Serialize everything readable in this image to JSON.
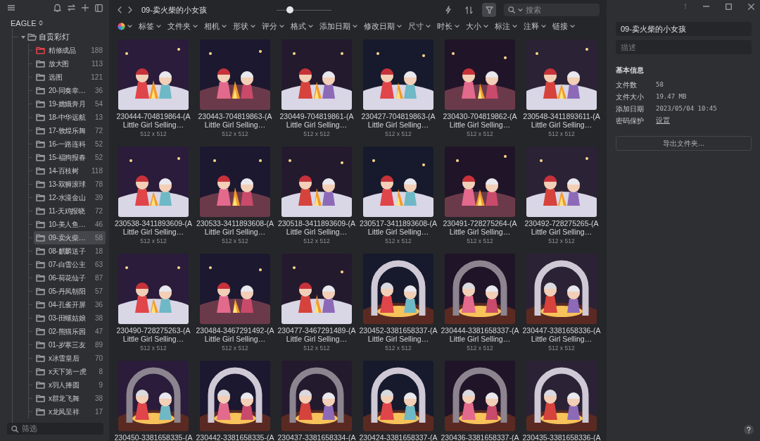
{
  "sidebar": {
    "library": "EAGLE",
    "root": {
      "name": "自贡彩灯",
      "expanded": true,
      "children": [
        {
          "name": "精修成品",
          "count": "188",
          "color": "#d9434b",
          "selected": false
        },
        {
          "name": "放大图",
          "count": "113",
          "color": "#9a9ba0",
          "selected": false
        },
        {
          "name": "选图",
          "count": "121",
          "color": "#9a9ba0",
          "selected": false
        },
        {
          "name": "20-同奏幸…",
          "count": "36",
          "color": "#9a9ba0",
          "selected": false
        },
        {
          "name": "19-嫦娥奔月",
          "count": "54",
          "color": "#9a9ba0",
          "selected": false
        },
        {
          "name": "18-中华远航",
          "count": "13",
          "color": "#9a9ba0",
          "selected": false
        },
        {
          "name": "17-敦煌乐舞",
          "count": "72",
          "color": "#9a9ba0",
          "selected": false
        },
        {
          "name": "16-一路连科",
          "count": "52",
          "color": "#9a9ba0",
          "selected": false
        },
        {
          "name": "15-福狗报春",
          "count": "52",
          "color": "#9a9ba0",
          "selected": false
        },
        {
          "name": "14-百枝树",
          "count": "118",
          "color": "#9a9ba0",
          "selected": false
        },
        {
          "name": "13-双狮滚球",
          "count": "78",
          "color": "#9a9ba0",
          "selected": false
        },
        {
          "name": "12-水漫金山",
          "count": "39",
          "color": "#9a9ba0",
          "selected": false
        },
        {
          "name": "11-天鸡报晓",
          "count": "72",
          "color": "#9a9ba0",
          "selected": false
        },
        {
          "name": "10-美人鱼…",
          "count": "46",
          "color": "#9a9ba0",
          "selected": false
        },
        {
          "name": "09-卖火柴…",
          "count": "58",
          "color": "#9a9ba0",
          "selected": true
        },
        {
          "name": "08-麒麟送子",
          "count": "18",
          "color": "#9a9ba0",
          "selected": false
        },
        {
          "name": "07-白雪公主",
          "count": "63",
          "color": "#9a9ba0",
          "selected": false
        },
        {
          "name": "06-荷花仙子",
          "count": "87",
          "color": "#9a9ba0",
          "selected": false
        },
        {
          "name": "05-丹凤朝阳",
          "count": "57",
          "color": "#9a9ba0",
          "selected": false
        },
        {
          "name": "04-孔雀开屏",
          "count": "36",
          "color": "#9a9ba0",
          "selected": false
        },
        {
          "name": "03-田螺姑娘",
          "count": "38",
          "color": "#9a9ba0",
          "selected": false
        },
        {
          "name": "02-熊猫乐园",
          "count": "47",
          "color": "#9a9ba0",
          "selected": false
        },
        {
          "name": "01-岁寒三友",
          "count": "89",
          "color": "#9a9ba0",
          "selected": false
        },
        {
          "name": "x冰雪皇后",
          "count": "70",
          "color": "#9a9ba0",
          "selected": false
        },
        {
          "name": "x天下第一虎",
          "count": "8",
          "color": "#9a9ba0",
          "selected": false
        },
        {
          "name": "x羽人捧圆",
          "count": "9",
          "color": "#9a9ba0",
          "selected": false
        },
        {
          "name": "x群龙飞舞",
          "count": "38",
          "color": "#9a9ba0",
          "selected": false
        },
        {
          "name": "x龙凤呈祥",
          "count": "17",
          "color": "#9a9ba0",
          "selected": false
        }
      ]
    },
    "filter_placeholder": "筛选"
  },
  "toolbar": {
    "title": "09-卖火柴的小女孩",
    "zoom": {
      "level": 0.25
    },
    "tools": [
      {
        "kind": "flash",
        "active": false
      },
      {
        "kind": "sort",
        "active": false
      },
      {
        "kind": "filter",
        "active": true
      }
    ],
    "search_placeholder": "搜索"
  },
  "filters": [
    {
      "kind": "color"
    },
    {
      "kind": "menu",
      "label": "标签"
    },
    {
      "kind": "menu",
      "label": "文件夹"
    },
    {
      "kind": "menu",
      "label": "相机"
    },
    {
      "kind": "menu",
      "label": "形状"
    },
    {
      "kind": "menu",
      "label": "评分"
    },
    {
      "kind": "menu",
      "label": "格式"
    },
    {
      "kind": "menu",
      "label": "添加日期"
    },
    {
      "kind": "menu",
      "label": "修改日期"
    },
    {
      "kind": "menu",
      "label": "尺寸"
    },
    {
      "kind": "menu",
      "label": "时长"
    },
    {
      "kind": "menu",
      "label": "大小"
    },
    {
      "kind": "menu",
      "label": "标注"
    },
    {
      "kind": "menu",
      "label": "注释"
    },
    {
      "kind": "menu",
      "label": "链接"
    }
  ],
  "items": [
    {
      "name": "230444-704819864-(A Little Girl Selling…",
      "size": "512 x 512"
    },
    {
      "name": "230443-704819863-(A Little Girl Selling…",
      "size": "512 x 512"
    },
    {
      "name": "230449-704819861-(A Little Girl Selling…",
      "size": "512 x 512"
    },
    {
      "name": "230427-704819863-(A Little Girl Selling…",
      "size": "512 x 512"
    },
    {
      "name": "230430-704819862-(A Little Girl Selling…",
      "size": "512 x 512"
    },
    {
      "name": "230548-3411893611-(A Little Girl Selling…",
      "size": "512 x 512"
    },
    {
      "name": "230538-3411893609-(A Little Girl Selling…",
      "size": "512 x 512"
    },
    {
      "name": "230533-3411893608-(A Little Girl Selling…",
      "size": "512 x 512"
    },
    {
      "name": "230518-3411893609-(A Little Girl Selling…",
      "size": "512 x 512"
    },
    {
      "name": "230517-3411893608-(A Little Girl Selling…",
      "size": "512 x 512"
    },
    {
      "name": "230491-728275264-(A Little Girl Selling…",
      "size": "512 x 512"
    },
    {
      "name": "230492-728275265-(A Little Girl Selling…",
      "size": "512 x 512"
    },
    {
      "name": "230490-728275263-(A Little Girl Selling…",
      "size": "512 x 512"
    },
    {
      "name": "230484-3467291492-(A Little Girl Selling…",
      "size": "512 x 512"
    },
    {
      "name": "230477-3467291489-(A Little Girl Selling…",
      "size": "512 x 512"
    },
    {
      "name": "230452-3381658337-(A Little Girl Selling…",
      "size": "512 x 512"
    },
    {
      "name": "230444-3381658337-(A Little Girl Selling…",
      "size": "512 x 512"
    },
    {
      "name": "230447-3381658336-(A Little Girl Selling…",
      "size": "512 x 512"
    },
    {
      "name": "230450-3381658335-(A"
    },
    {
      "name": "230442-3381658335-(A"
    },
    {
      "name": "230437-3381658334-(A"
    },
    {
      "name": "230424-3381658337-(A"
    },
    {
      "name": "230436-3381658337-(A"
    },
    {
      "name": "230435-3381658336-(A"
    }
  ],
  "inspector": {
    "name": "09-卖火柴的小女孩",
    "description_placeholder": "描述",
    "section": "基本信息",
    "properties": [
      {
        "kind": "text",
        "label": "文件数",
        "value": "58"
      },
      {
        "kind": "text",
        "label": "文件大小",
        "value": "19.47 MB"
      },
      {
        "kind": "text",
        "label": "添加日期",
        "value": "2023/05/04 10:45"
      },
      {
        "kind": "link",
        "label": "密码保护",
        "value": "设置"
      }
    ],
    "export_button": "导出文件夹..."
  }
}
